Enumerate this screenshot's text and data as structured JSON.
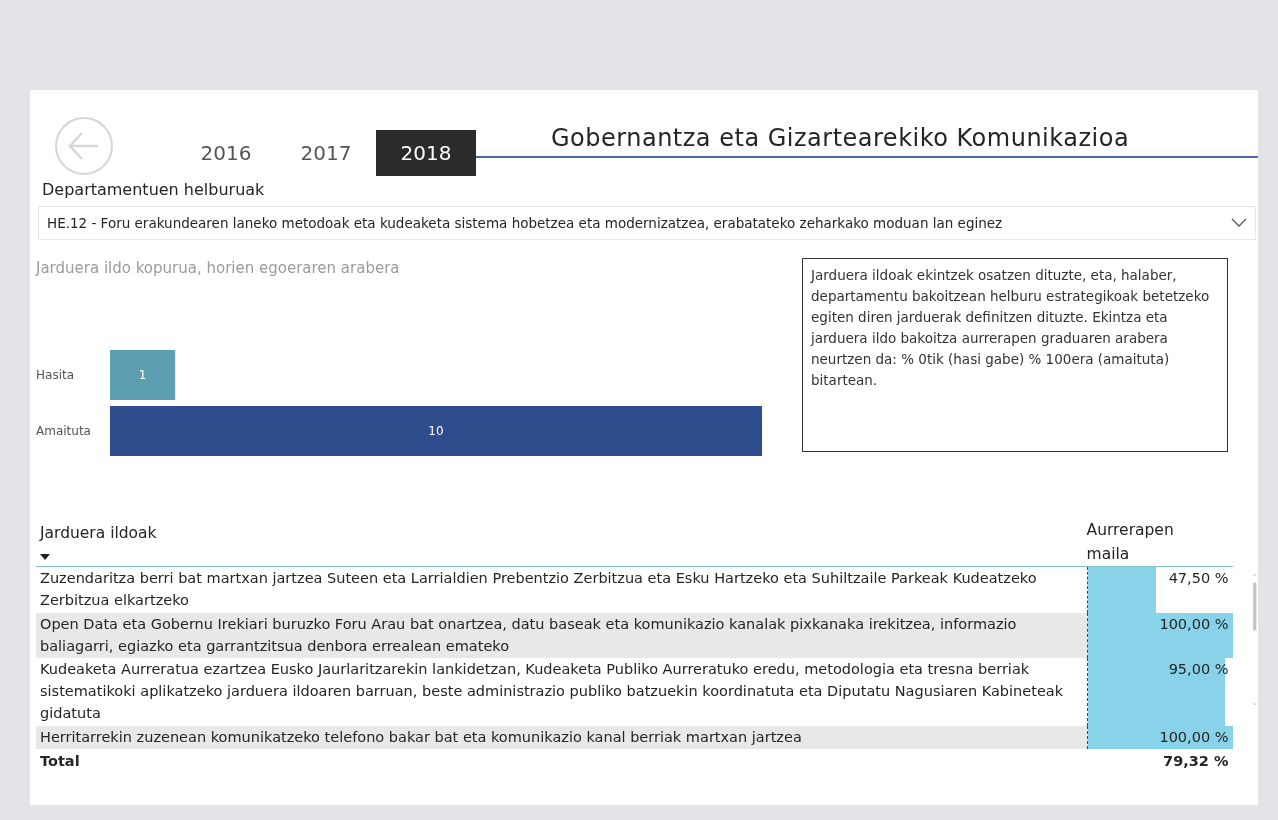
{
  "tabs": [
    {
      "label": "2016",
      "selected": false
    },
    {
      "label": "2017",
      "selected": false
    },
    {
      "label": "2018",
      "selected": true
    }
  ],
  "title": "Gobernantza eta Gizartearekiko Komunikazioa",
  "filter": {
    "label": "Departamentuen helburuak",
    "value": "HE.12 - Foru erakundearen laneko metodoak eta kudeaketa sistema hobetzea eta modernizatzea, erabatateko zeharkako moduan lan eginez"
  },
  "chart": {
    "chart_data": {
      "type": "bar",
      "orientation": "horizontal",
      "title": "Jarduera ildo kopurua, horien egoeraren arabera",
      "categories": [
        "Hasita",
        "Amaituta"
      ],
      "values": [
        1,
        10
      ],
      "data_labels": true
    }
  },
  "info_text": "Jarduera ildoak ekintzek osatzen dituzte, eta, halaber, departamentu bakoitzean helburu estrategikoak betetzeko egiten diren jarduerak definitzen dituzte. Ekintza eta jarduera ildo bakoitza aurrerapen graduaren arabera neurtzen da: % 0tik (hasi gabe) % 100era (amaituta) bitartean.",
  "table": {
    "columns": [
      "Jarduera ildoak",
      "Aurrerapen maila"
    ],
    "rows": [
      {
        "name": "Zuzendaritza berri bat martxan jartzea Suteen eta Larrialdien Prebentzio Zerbitzua eta Esku Hartzeko eta Suhiltzaile Parkeak Kudeatzeko Zerbitzua elkartzeko",
        "value": "47,50 %",
        "level": 0.475
      },
      {
        "name": "Open Data eta Gobernu Irekiari buruzko Foru Arau bat onartzea, datu baseak eta komunikazio kanalak pixkanaka irekitzea, informazio baliagarri, egiazko eta garrantzitsua denbora errealean emateko",
        "value": "100,00 %",
        "level": 1
      },
      {
        "name": "Kudeaketa Aurreratua ezartzea Eusko Jaurlaritzarekin lankidetzan, Kudeaketa Publiko Aurreratuko eredu, metodologia eta tresna berriak sistematikoki aplikatzeko jarduera ildoaren barruan, beste administrazio publiko batzuekin koordinatuta eta Diputatu Nagusiaren Kabineteak gidatuta",
        "value": "95,00 %",
        "level": 0.95
      },
      {
        "name": "Herritarrekin zuzenean komunikatzeko telefono bakar bat eta komunikazio kanal berriak martxan jartzea",
        "value": "100,00 %",
        "level": 1
      }
    ],
    "total": {
      "label": "Total",
      "value": "79,32 %"
    }
  }
}
